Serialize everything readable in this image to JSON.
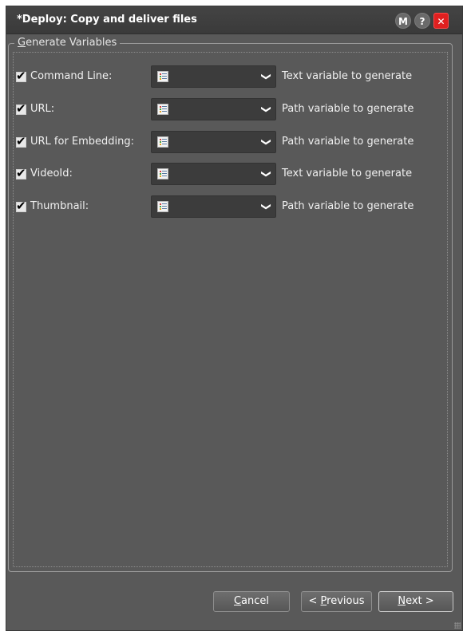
{
  "window": {
    "title": "*Deploy: Copy and deliver files",
    "buttons": {
      "m": "M",
      "help": "?",
      "close": "✕"
    }
  },
  "group": {
    "legend_first": "G",
    "legend_rest": "enerate Variables"
  },
  "rows": [
    {
      "label": "Command Line:",
      "checked": true,
      "description": "Text variable to generate"
    },
    {
      "label": "URL:",
      "checked": true,
      "description": "Path variable to generate"
    },
    {
      "label": "URL for Embedding:",
      "checked": true,
      "description": "Path variable to generate"
    },
    {
      "label": "VideoId:",
      "checked": true,
      "description": "Text variable to generate"
    },
    {
      "label": "Thumbnail:",
      "checked": true,
      "description": "Path variable to generate"
    }
  ],
  "footer": {
    "cancel_mnemonic": "C",
    "cancel_rest": "ancel",
    "prev_prefix": "< ",
    "prev_mnemonic": "P",
    "prev_rest": "revious",
    "next_mnemonic": "N",
    "next_rest": "ext >"
  },
  "colors": {
    "background": "#595959",
    "titlebar": "#3a3a3a",
    "close": "#e02020"
  }
}
